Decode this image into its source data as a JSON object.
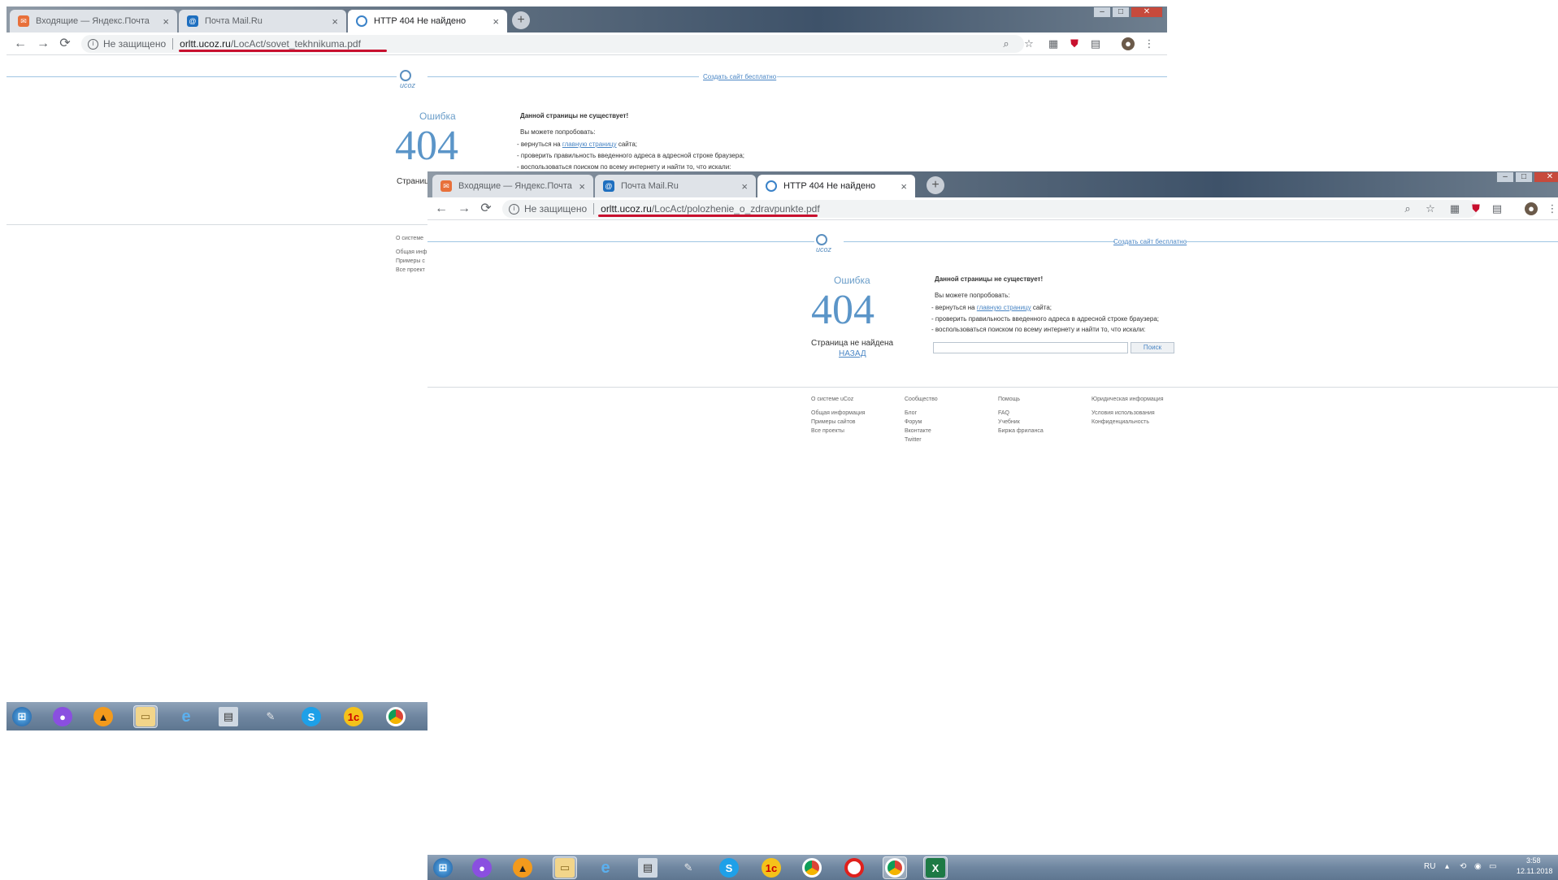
{
  "back_window": {
    "tabs": [
      {
        "label": "Входящие — Яндекс.Почта",
        "close": "×"
      },
      {
        "label": "Почта Mail.Ru",
        "close": "×"
      },
      {
        "label": "HTTP 404 Не найдено",
        "close": "×"
      }
    ],
    "new_tab": "+",
    "not_secure": "Не защищено",
    "url_host": "orltt.ucoz.ru",
    "url_path": "/LocAct/sovet_tekhnikuma.pdf",
    "partial_not_found": "Страниц",
    "partial_footer": [
      "О системе",
      "Общая инф",
      "Примеры с",
      "Все проект"
    ]
  },
  "front_window": {
    "tabs": [
      {
        "label": "Входящие — Яндекс.Почта",
        "close": "×"
      },
      {
        "label": "Почта Mail.Ru",
        "close": "×"
      },
      {
        "label": "HTTP 404 Не найдено",
        "close": "×"
      }
    ],
    "new_tab": "+",
    "not_secure": "Не защищено",
    "url_host": "orltt.ucoz.ru",
    "url_path": "/LocAct/polozhenie_o_zdravpunkte.pdf"
  },
  "page": {
    "logo_text": "ucoz",
    "create_site": "Создать сайт бесплатно",
    "error_word": "Ошибка",
    "error_code": "404",
    "no_such_page": "Данной страницы не существует!",
    "you_can_try": "Вы можете попробовать:",
    "opt1_prefix": "- вернуться на ",
    "opt1_link": "главную страницу",
    "opt1_suffix": " сайта;",
    "opt2": "- проверить правильность введенного адреса в адресной строке браузера;",
    "opt3": "- воспользоваться поиском по всему интернету и найти то, что искали:",
    "not_found": "Страница не найдена",
    "back": "НАЗАД",
    "search_button": "Поиск"
  },
  "footer": {
    "col1": {
      "title": "О системе uCoz",
      "items": [
        "Общая информация",
        "Примеры сайтов",
        "Все проекты"
      ]
    },
    "col2": {
      "title": "Сообщество",
      "items": [
        "Блог",
        "Форум",
        "Вконтакте",
        "Twitter"
      ]
    },
    "col3": {
      "title": "Помощь",
      "items": [
        "FAQ",
        "Учебник",
        "Биржа фриланса"
      ]
    },
    "col4": {
      "title": "Юридическая информация",
      "items": [
        "Условия использования",
        "Конфиденциальность"
      ]
    }
  },
  "taskbar": {
    "apps": [
      "start",
      "microphone",
      "aimp",
      "explorer",
      "internet-explorer",
      "calculator",
      "paint",
      "skype",
      "1c",
      "chrome",
      "opera",
      "chrome-active",
      "excel"
    ],
    "lang": "RU",
    "time": "3:58",
    "date": "12.11.2018"
  }
}
